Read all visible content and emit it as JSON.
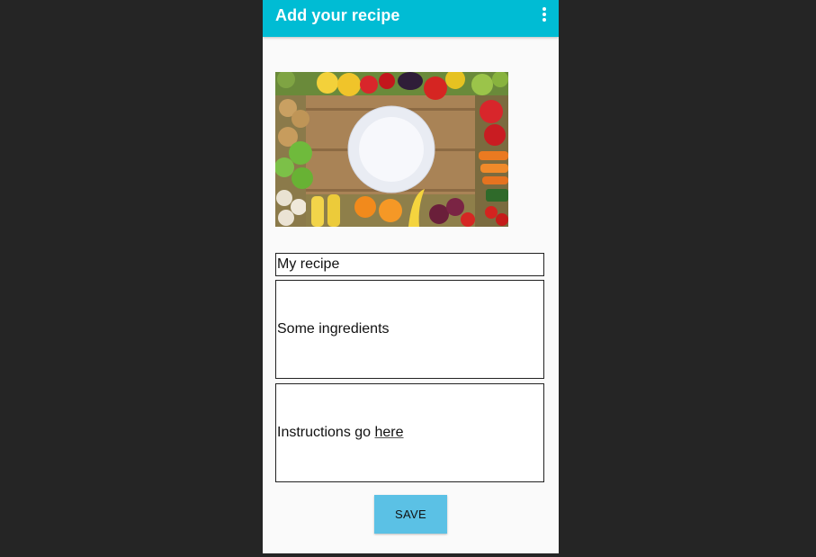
{
  "appbar": {
    "title": "Add your recipe",
    "overflow_icon": "more-vert-icon",
    "color": "#00bcd4"
  },
  "image": {
    "description_icon": "vegetables-plate-image"
  },
  "form": {
    "title_value": "My recipe",
    "ingredients_value": "Some ingredients",
    "instructions_prefix": "Instructions go ",
    "instructions_link": "here"
  },
  "actions": {
    "save_label": "SAVE",
    "save_color": "#5bc1e5"
  }
}
